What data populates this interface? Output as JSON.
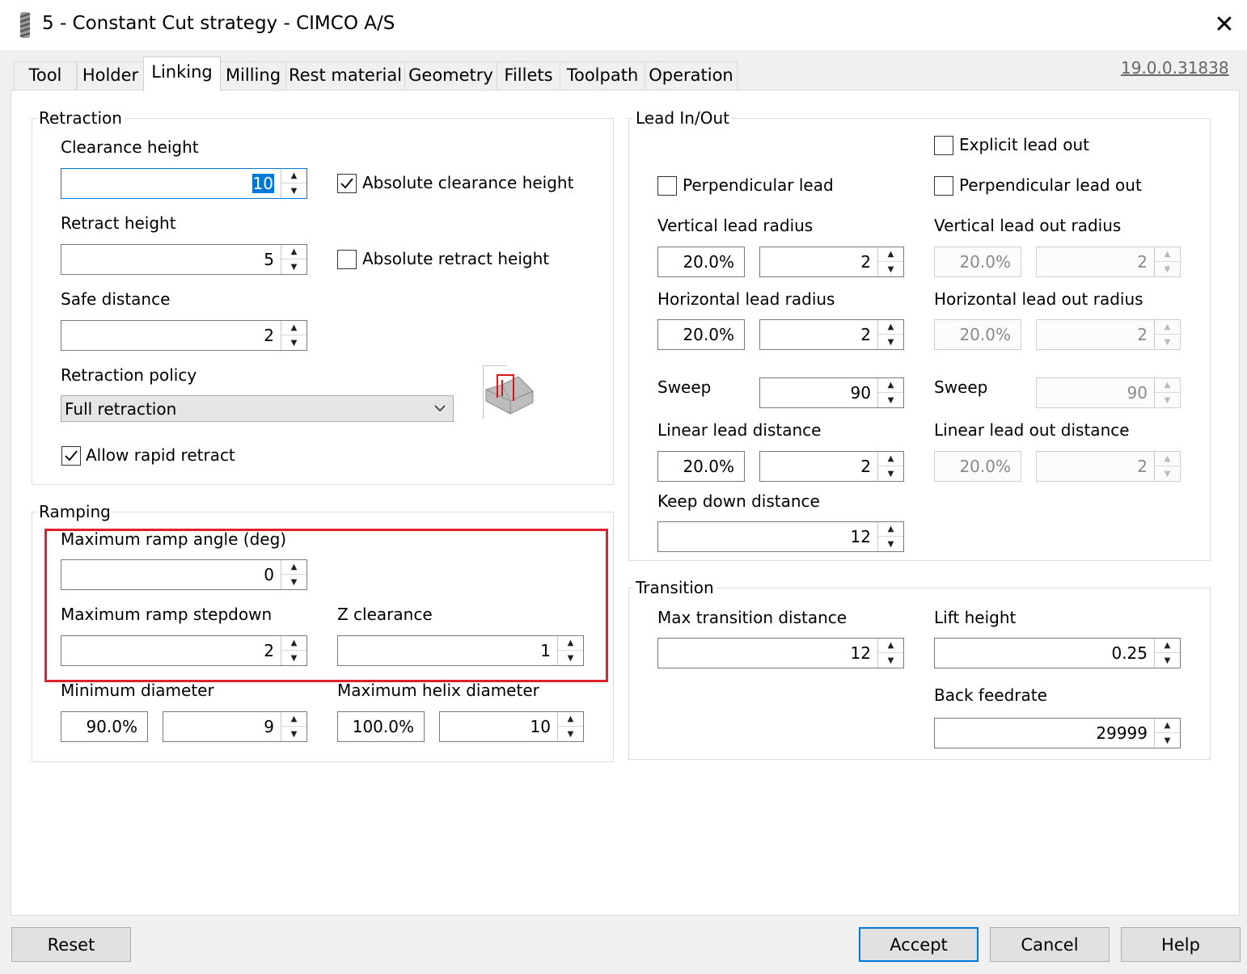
{
  "window": {
    "title": "5 - Constant Cut strategy - CIMCO A/S",
    "version": "19.0.0.31838"
  },
  "tabs": [
    "Tool",
    "Holder",
    "Linking",
    "Milling",
    "Rest material",
    "Geometry",
    "Fillets",
    "Toolpath",
    "Operation"
  ],
  "active_tab": "Linking",
  "retraction": {
    "title": "Retraction",
    "clearance_height_label": "Clearance height",
    "clearance_height": "10",
    "absolute_clearance_label": "Absolute clearance height",
    "retract_height_label": "Retract height",
    "retract_height": "5",
    "absolute_retract_label": "Absolute retract height",
    "safe_distance_label": "Safe distance",
    "safe_distance": "2",
    "policy_label": "Retraction policy",
    "policy_value": "Full retraction",
    "allow_rapid_label": "Allow rapid retract"
  },
  "ramping": {
    "title": "Ramping",
    "max_angle_label": "Maximum ramp angle (deg)",
    "max_angle": "0",
    "max_stepdown_label": "Maximum ramp stepdown",
    "max_stepdown": "2",
    "z_clearance_label": "Z clearance",
    "z_clearance": "1",
    "min_diameter_label": "Minimum diameter",
    "min_diameter_pct": "90.0%",
    "min_diameter": "9",
    "max_helix_label": "Maximum helix diameter",
    "max_helix_pct": "100.0%",
    "max_helix": "10"
  },
  "lead": {
    "title": "Lead In/Out",
    "explicit_lead_out_label": "Explicit lead out",
    "perpendicular_lead_label": "Perpendicular lead",
    "perpendicular_lead_out_label": "Perpendicular lead out",
    "vertical_radius_label": "Vertical lead radius",
    "vertical_radius_pct": "20.0%",
    "vertical_radius": "2",
    "vertical_out_label": "Vertical lead out radius",
    "vertical_out_pct": "20.0%",
    "vertical_out": "2",
    "horizontal_radius_label": "Horizontal lead radius",
    "horizontal_radius_pct": "20.0%",
    "horizontal_radius": "2",
    "horizontal_out_label": "Horizontal lead out radius",
    "horizontal_out_pct": "20.0%",
    "horizontal_out": "2",
    "sweep_label": "Sweep",
    "sweep": "90",
    "sweep_out_label": "Sweep",
    "sweep_out": "90",
    "linear_distance_label": "Linear lead distance",
    "linear_distance_pct": "20.0%",
    "linear_distance": "2",
    "linear_out_label": "Linear lead out distance",
    "linear_out_pct": "20.0%",
    "linear_out": "2",
    "keep_down_label": "Keep down distance",
    "keep_down": "12"
  },
  "transition": {
    "title": "Transition",
    "max_distance_label": "Max transition distance",
    "max_distance": "12",
    "lift_height_label": "Lift height",
    "lift_height": "0.25",
    "back_feedrate_label": "Back feedrate",
    "back_feedrate": "29999"
  },
  "buttons": {
    "reset": "Reset",
    "accept": "Accept",
    "cancel": "Cancel",
    "help": "Help"
  },
  "colors": {
    "accent": "#0078d7",
    "highlight": "#e0202a"
  }
}
